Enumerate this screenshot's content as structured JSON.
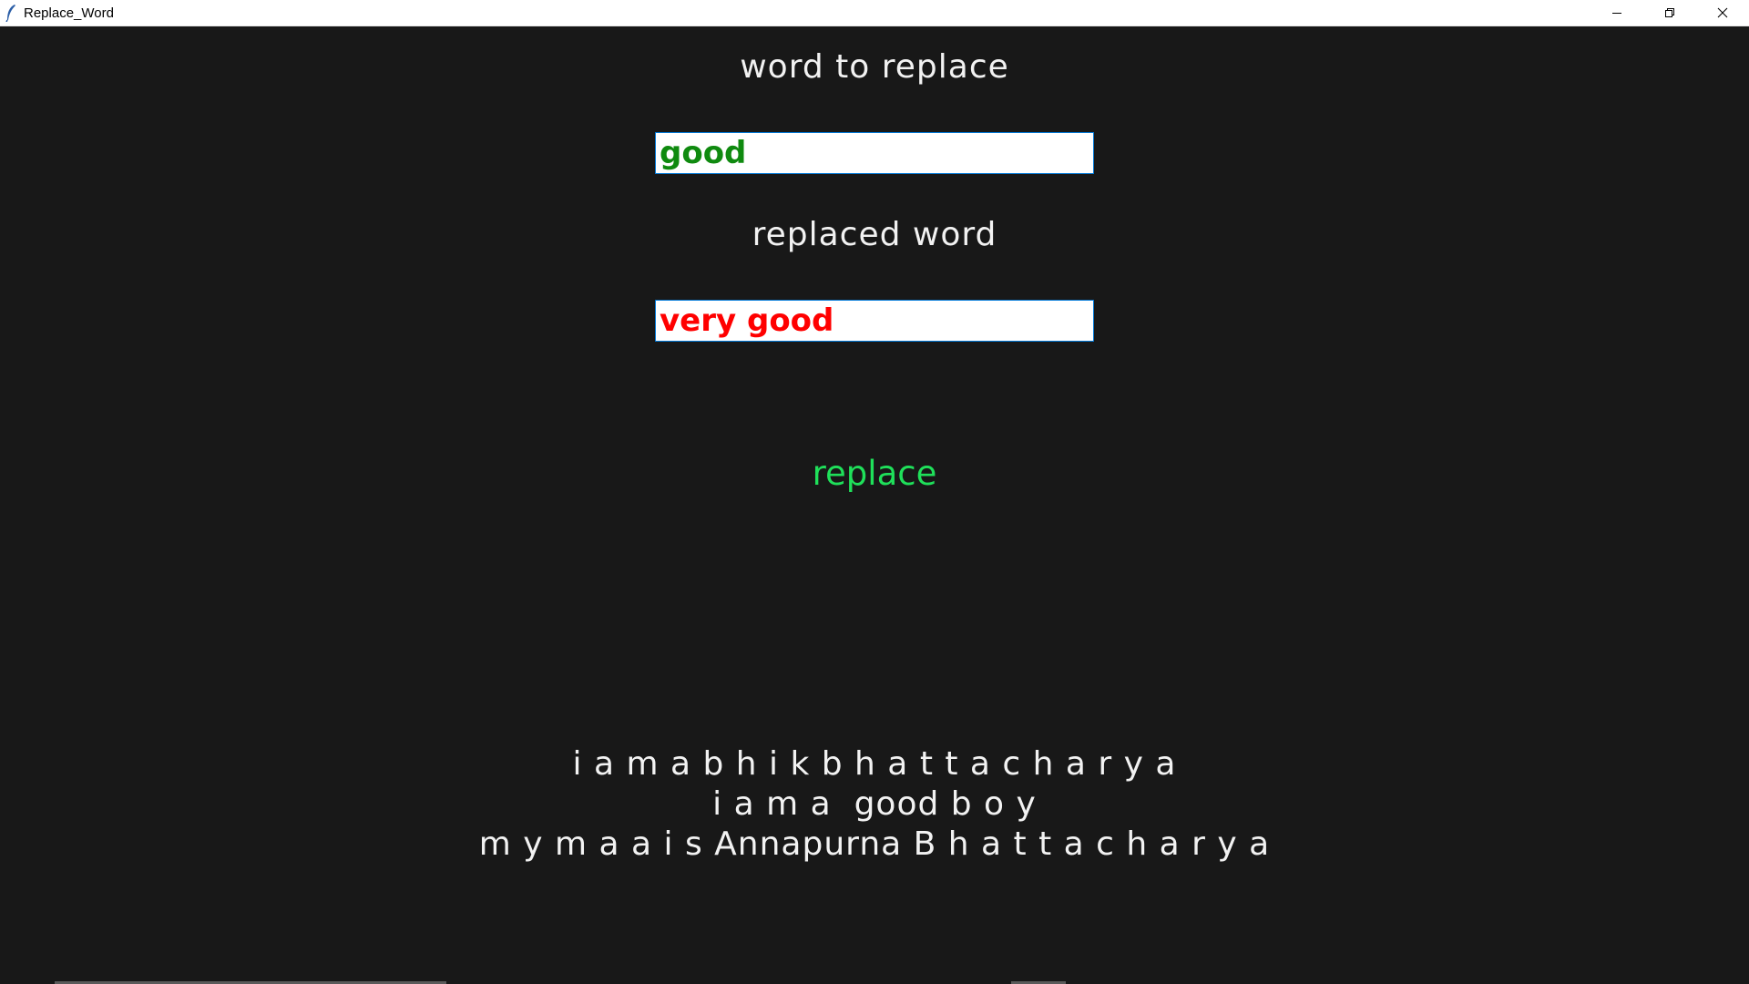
{
  "window": {
    "title": "Replace_Word",
    "icon": "feather-icon",
    "controls": [
      "minimize-icon",
      "restore-icon",
      "close-icon"
    ]
  },
  "form": {
    "word_to_replace_label": "word to replace",
    "word_to_replace_value": "good",
    "replaced_word_label": "replaced word",
    "replaced_word_value": "very good",
    "replace_button_label": "replace"
  },
  "output": {
    "lines": [
      "i a m a b h i k b h a t t a c h a r y a",
      "i a m a  good b o y",
      "m y m a a i s Annapurna B h a t t a c h a r y a"
    ]
  },
  "colors": {
    "background": "#181818",
    "label_text": "#f2f2f2",
    "word_to_replace_text": "#0f8a0f",
    "replaced_word_text": "#ff0000",
    "replace_button_text": "#1fe05a"
  }
}
